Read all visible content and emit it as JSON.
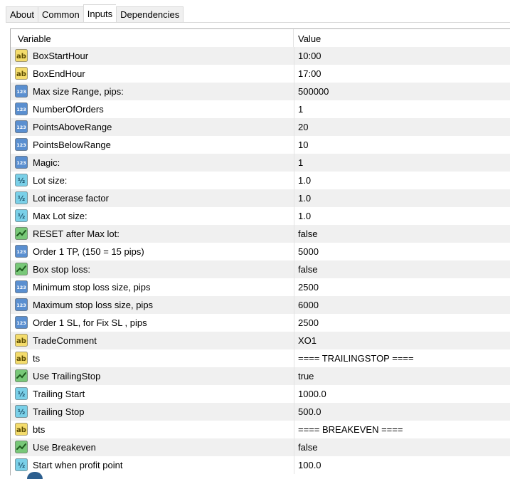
{
  "tabs": [
    {
      "label": "About"
    },
    {
      "label": "Common"
    },
    {
      "label": "Inputs",
      "active": true
    },
    {
      "label": "Dependencies"
    }
  ],
  "columns": {
    "variable": "Variable",
    "value": "Value"
  },
  "icon_types": {
    "ab": {
      "name": "string-type-icon",
      "text": "ab",
      "bg": "#f4dc6c",
      "fg": "#5a4a00"
    },
    "int": {
      "name": "integer-type-icon",
      "text": "123",
      "bg": "#5a8fd0",
      "fg": "#ffffff"
    },
    "dbl": {
      "name": "double-type-icon",
      "text": "½",
      "bg": "#7ad0e8",
      "fg": "#1a4d66"
    },
    "bool": {
      "name": "boolean-type-icon",
      "text": "",
      "bg": "#78c878",
      "fg": "#1e5a1e"
    }
  },
  "rows": [
    {
      "type": "ab",
      "name": "BoxStartHour",
      "value": "10:00"
    },
    {
      "type": "ab",
      "name": "BoxEndHour",
      "value": "17:00"
    },
    {
      "type": "int",
      "name": "Max size Range, pips:",
      "value": "500000"
    },
    {
      "type": "int",
      "name": "NumberOfOrders",
      "value": "1"
    },
    {
      "type": "int",
      "name": "PointsAboveRange",
      "value": "20"
    },
    {
      "type": "int",
      "name": "PointsBelowRange",
      "value": "10"
    },
    {
      "type": "int",
      "name": "Magic:",
      "value": "1"
    },
    {
      "type": "dbl",
      "name": "Lot size:",
      "value": "1.0"
    },
    {
      "type": "dbl",
      "name": "Lot incerase factor",
      "value": "1.0"
    },
    {
      "type": "dbl",
      "name": "Max Lot size:",
      "value": "1.0"
    },
    {
      "type": "bool",
      "name": "RESET after Max lot:",
      "value": "false"
    },
    {
      "type": "int",
      "name": "Order 1 TP, (150 = 15 pips)",
      "value": "5000"
    },
    {
      "type": "bool",
      "name": "Box stop loss:",
      "value": "false"
    },
    {
      "type": "int",
      "name": "Minimum stop loss size, pips",
      "value": "2500"
    },
    {
      "type": "int",
      "name": "Maximum stop loss size, pips",
      "value": "6000"
    },
    {
      "type": "int",
      "name": "Order 1 SL, for Fix SL , pips",
      "value": "2500"
    },
    {
      "type": "ab",
      "name": "TradeComment",
      "value": "XO1"
    },
    {
      "type": "ab",
      "name": "ts",
      "value": "==== TRAILINGSTOP ===="
    },
    {
      "type": "bool",
      "name": "Use TrailingStop",
      "value": "true"
    },
    {
      "type": "dbl",
      "name": "Trailing Start",
      "value": "1000.0"
    },
    {
      "type": "dbl",
      "name": "Trailing Stop",
      "value": "500.0"
    },
    {
      "type": "ab",
      "name": "bts",
      "value": "==== BREAKEVEN ===="
    },
    {
      "type": "bool",
      "name": "Use Breakeven",
      "value": "false"
    },
    {
      "type": "dbl",
      "name": "Start when profit point",
      "value": "100.0"
    }
  ]
}
